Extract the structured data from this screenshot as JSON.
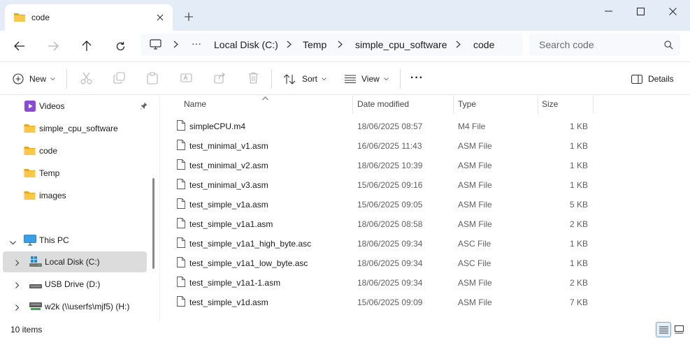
{
  "window": {
    "tab_title": "code",
    "new_tab_symbol": "+",
    "close_symbol": "✕",
    "minimize_symbol": "—",
    "maximize_symbol": "☐"
  },
  "address": {
    "crumbs": [
      "Local Disk (C:)",
      "Temp",
      "simple_cpu_software",
      "code"
    ],
    "overflow": "···",
    "search_placeholder": "Search code"
  },
  "toolbar": {
    "new_label": "New",
    "sort_label": "Sort",
    "view_label": "View",
    "more_label": "···",
    "details_label": "Details"
  },
  "sidebar": {
    "items": [
      {
        "label": "Videos"
      },
      {
        "label": "simple_cpu_software"
      },
      {
        "label": "code"
      },
      {
        "label": "Temp"
      },
      {
        "label": "images"
      },
      {
        "label": "This PC"
      },
      {
        "label": "Local Disk (C:)"
      },
      {
        "label": "USB Drive (D:)"
      },
      {
        "label": "w2k (\\\\userfs\\mjf5) (H:)"
      }
    ]
  },
  "columns": {
    "name": "Name",
    "date": "Date modified",
    "type": "Type",
    "size": "Size"
  },
  "files": [
    {
      "name": "simpleCPU.m4",
      "date": "18/06/2025 08:57",
      "type": "M4 File",
      "size": "1 KB"
    },
    {
      "name": "test_minimal_v1.asm",
      "date": "16/06/2025 11:43",
      "type": "ASM File",
      "size": "1 KB"
    },
    {
      "name": "test_minimal_v2.asm",
      "date": "18/06/2025 10:39",
      "type": "ASM File",
      "size": "1 KB"
    },
    {
      "name": "test_minimal_v3.asm",
      "date": "15/06/2025 09:16",
      "type": "ASM File",
      "size": "1 KB"
    },
    {
      "name": "test_simple_v1a.asm",
      "date": "15/06/2025 09:05",
      "type": "ASM File",
      "size": "5 KB"
    },
    {
      "name": "test_simple_v1a1.asm",
      "date": "18/06/2025 08:58",
      "type": "ASM File",
      "size": "2 KB"
    },
    {
      "name": "test_simple_v1a1_high_byte.asc",
      "date": "18/06/2025 09:34",
      "type": "ASC File",
      "size": "1 KB"
    },
    {
      "name": "test_simple_v1a1_low_byte.asc",
      "date": "18/06/2025 09:34",
      "type": "ASC File",
      "size": "1 KB"
    },
    {
      "name": "test_simple_v1a1-1.asm",
      "date": "18/06/2025 09:34",
      "type": "ASM File",
      "size": "2 KB"
    },
    {
      "name": "test_simple_v1d.asm",
      "date": "15/06/2025 09:09",
      "type": "ASM File",
      "size": "7 KB"
    }
  ],
  "status": {
    "item_count": "10 items"
  },
  "colors": {
    "titlebar_bg": "#e3ecf7",
    "folder": "#f3c23b",
    "selection": "#dcdcdc",
    "accent": "#0a64c8"
  }
}
